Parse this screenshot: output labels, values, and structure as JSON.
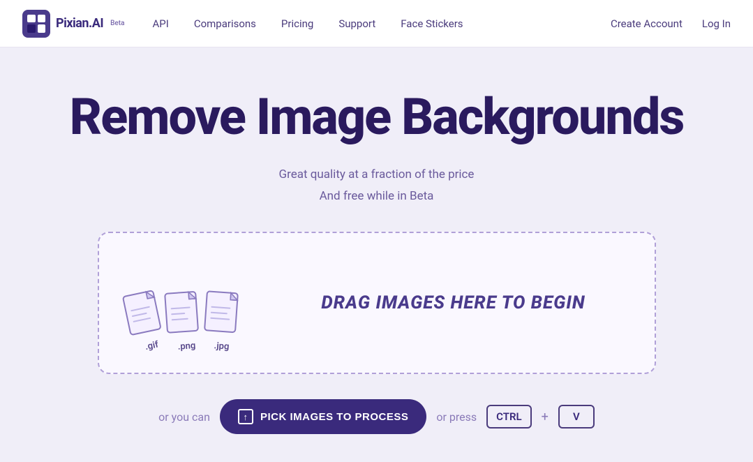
{
  "brand": {
    "name": "Pixian.AI",
    "beta_label": "Beta"
  },
  "nav": {
    "links": [
      {
        "label": "API",
        "id": "nav-api"
      },
      {
        "label": "Comparisons",
        "id": "nav-comparisons"
      },
      {
        "label": "Pricing",
        "id": "nav-pricing"
      },
      {
        "label": "Support",
        "id": "nav-support"
      },
      {
        "label": "Face Stickers",
        "id": "nav-face-stickers"
      }
    ],
    "create_account": "Create Account",
    "log_in": "Log In"
  },
  "hero": {
    "title": "Remove Image Backgrounds",
    "subtitle_line1": "Great quality at a fraction of the price",
    "subtitle_line2": "And free while in Beta"
  },
  "dropzone": {
    "drag_text": "DRAG IMAGES HERE TO BEGIN",
    "file_types": [
      {
        "label": ".gif"
      },
      {
        "label": ".png"
      },
      {
        "label": ".jpg"
      }
    ]
  },
  "cta": {
    "prefix": "or you can",
    "button_label": "PICK IMAGES TO PROCESS",
    "middle_text": "or press",
    "ctrl_key": "CTRL",
    "plus": "+",
    "v_key": "V"
  }
}
